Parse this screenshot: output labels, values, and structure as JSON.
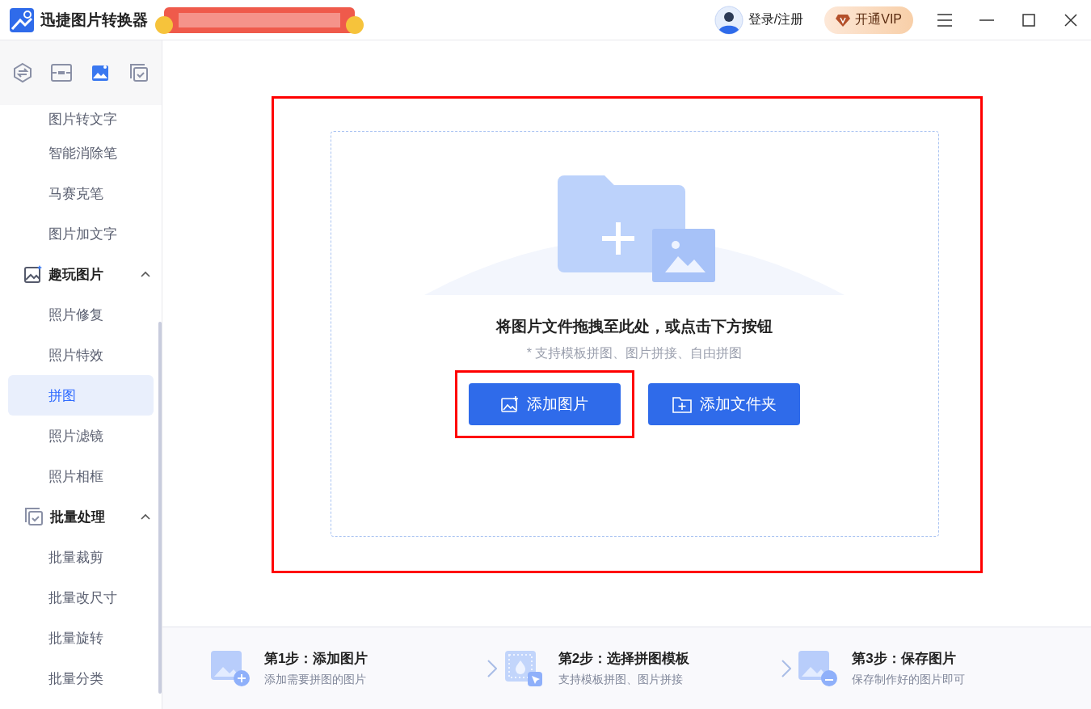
{
  "window": {
    "title": "迅捷图片转换器",
    "login": "登录/注册",
    "vip": "开通VIP"
  },
  "sidebar": {
    "tabs": [
      {
        "kind": "convert",
        "selected": false
      },
      {
        "kind": "edit",
        "selected": false
      },
      {
        "kind": "image",
        "selected": true
      },
      {
        "kind": "batch",
        "selected": false
      }
    ],
    "items": [
      {
        "kind": "item",
        "label": "图片转文字",
        "selected": false
      },
      {
        "kind": "item",
        "label": "智能消除笔",
        "selected": false
      },
      {
        "kind": "item",
        "label": "马赛克笔",
        "selected": false
      },
      {
        "kind": "item",
        "label": "图片加文字",
        "selected": false
      },
      {
        "kind": "group",
        "label": "趣玩图片",
        "expanded": true
      },
      {
        "kind": "item",
        "label": "照片修复",
        "selected": false
      },
      {
        "kind": "item",
        "label": "照片特效",
        "selected": false
      },
      {
        "kind": "item",
        "label": "拼图",
        "selected": true
      },
      {
        "kind": "item",
        "label": "照片滤镜",
        "selected": false
      },
      {
        "kind": "item",
        "label": "照片相框",
        "selected": false
      },
      {
        "kind": "group",
        "label": "批量处理",
        "expanded": true
      },
      {
        "kind": "item",
        "label": "批量裁剪",
        "selected": false
      },
      {
        "kind": "item",
        "label": "批量改尺寸",
        "selected": false
      },
      {
        "kind": "item",
        "label": "批量旋转",
        "selected": false
      },
      {
        "kind": "item",
        "label": "批量分类",
        "selected": false
      }
    ]
  },
  "dropzone": {
    "title": "将图片文件拖拽至此处，或点击下方按钮",
    "hint": "* 支持模板拼图、图片拼接、自由拼图",
    "buttons": [
      {
        "kind": "image",
        "label": "添加图片",
        "highlighted": true
      },
      {
        "kind": "folder",
        "label": "添加文件夹",
        "highlighted": false
      }
    ]
  },
  "steps": [
    {
      "kind": "add",
      "title": "第1步：添加图片",
      "desc": "添加需要拼图的图片"
    },
    {
      "kind": "template",
      "title": "第2步：选择拼图模板",
      "desc": "支持模板拼图、图片拼接"
    },
    {
      "kind": "save",
      "title": "第3步：保存图片",
      "desc": "保存制作好的图片即可"
    }
  ]
}
